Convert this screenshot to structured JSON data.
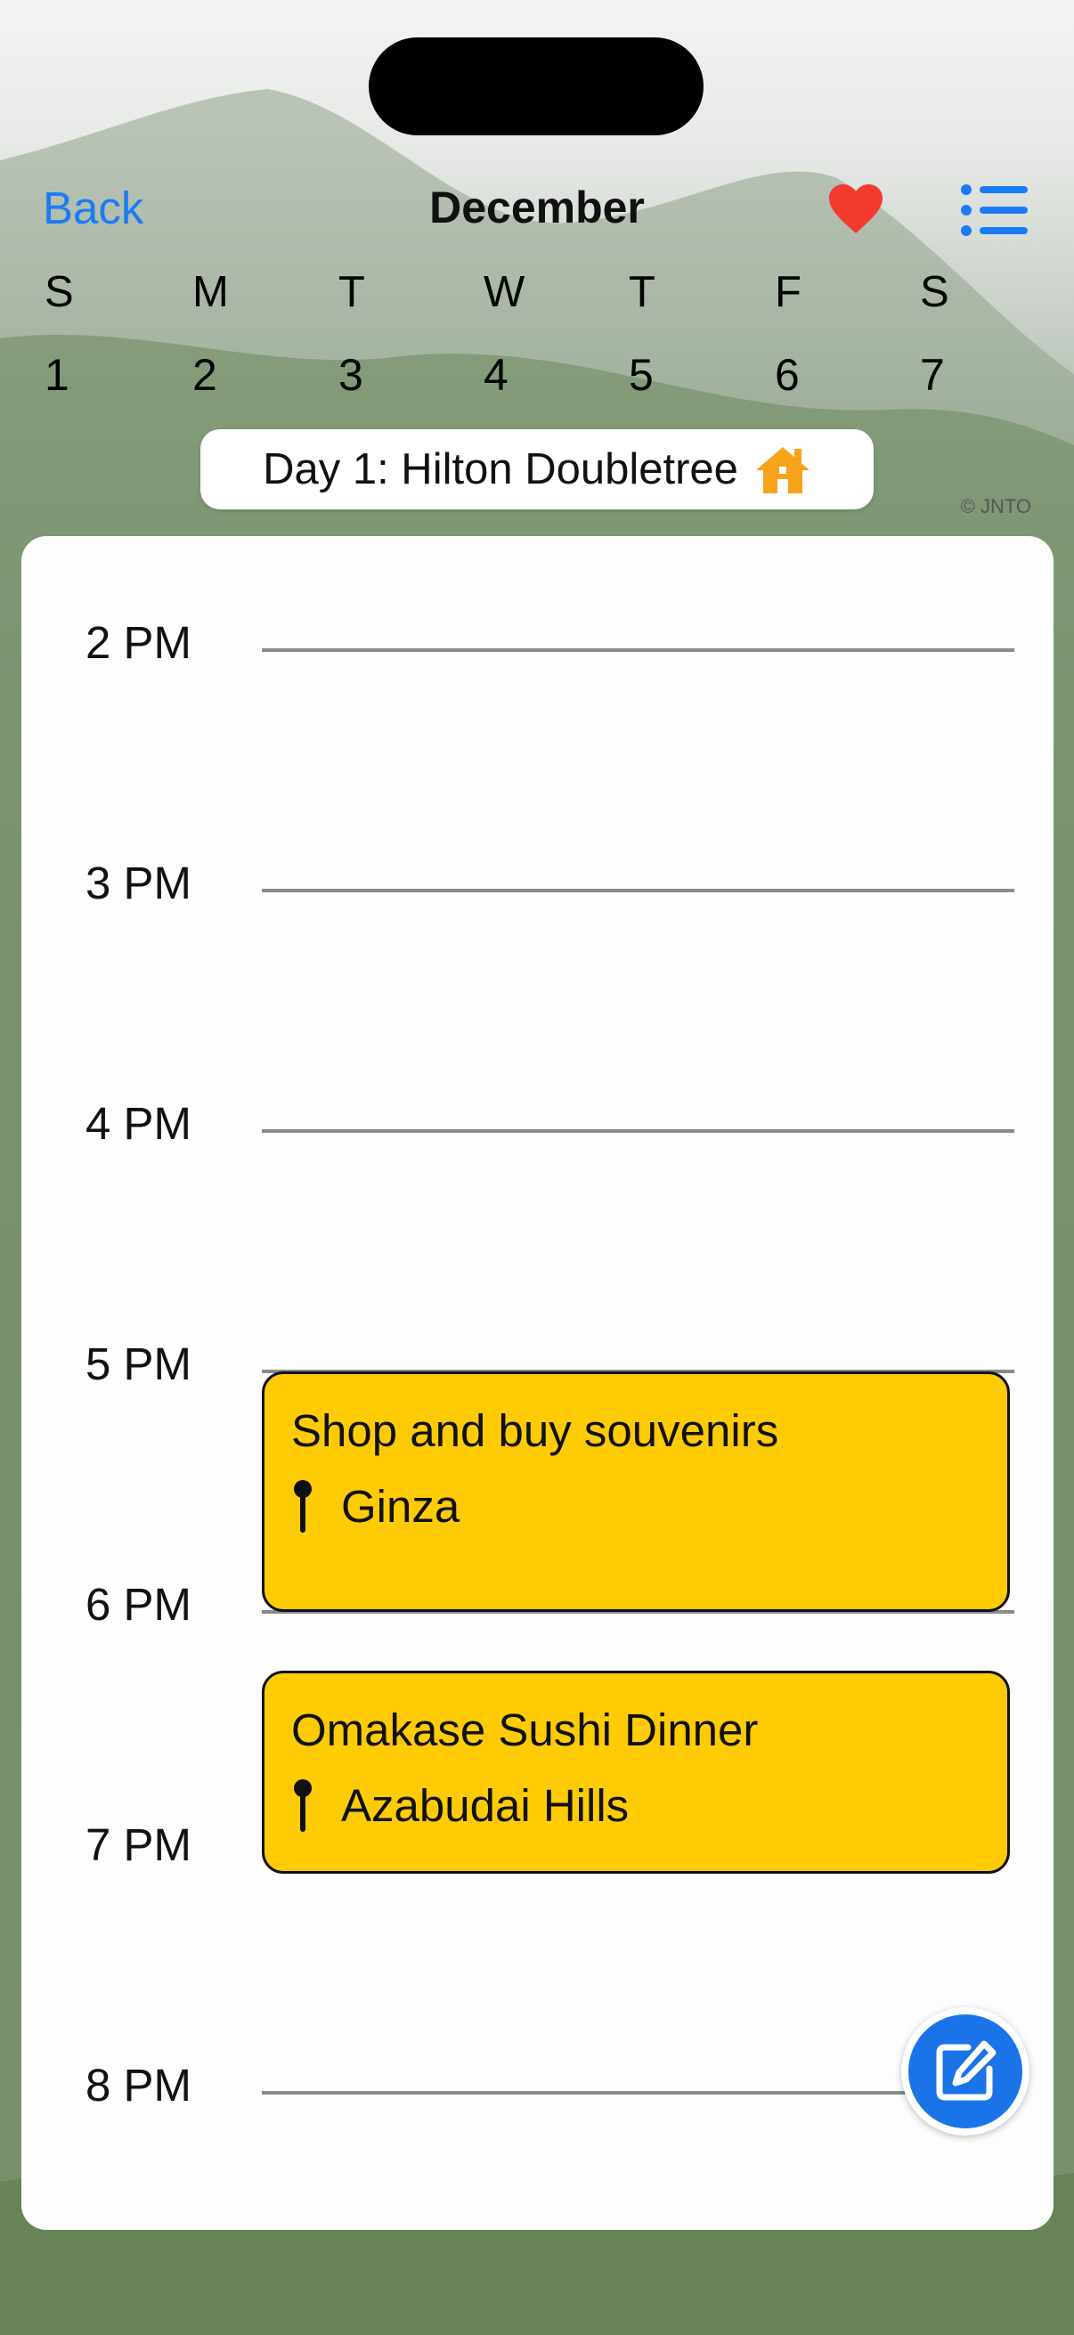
{
  "header": {
    "back_label": "Back",
    "month": "December",
    "favorite_icon": "heart-icon",
    "list_icon": "list-icon",
    "accent_color": "#1a7cf5"
  },
  "week": {
    "weekdays": [
      "S",
      "M",
      "T",
      "W",
      "T",
      "F",
      "S"
    ],
    "dates": [
      "1",
      "2",
      "3",
      "4",
      "5",
      "6",
      "7"
    ]
  },
  "day_banner": {
    "label": "Day 1: Hilton Doubletree",
    "icon": "home-icon"
  },
  "photo_credit": "© JNTO",
  "timeline": {
    "hours": [
      "2 PM",
      "3 PM",
      "4 PM",
      "5 PM",
      "6 PM",
      "7 PM",
      "8 PM"
    ],
    "events": [
      {
        "title": "Shop and buy souvenirs",
        "location": "Ginza",
        "color": "#ffcb05"
      },
      {
        "title": "Omakase Sushi Dinner",
        "location": "Azabudai Hills",
        "color": "#ffcb05"
      }
    ]
  },
  "fab": {
    "icon": "edit-icon"
  }
}
